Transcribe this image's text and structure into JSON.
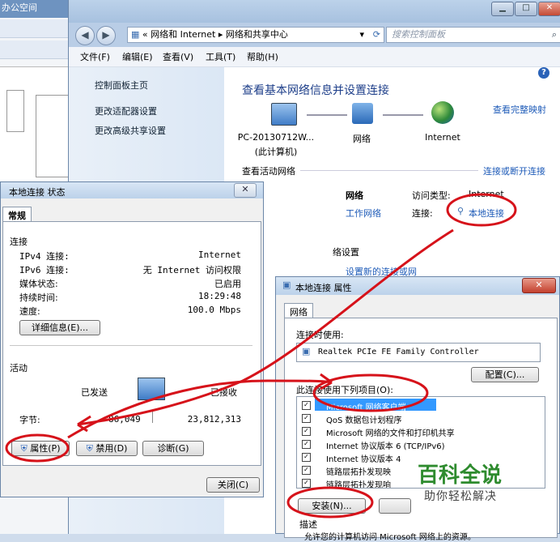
{
  "bg_app": {
    "title": "办公空间"
  },
  "window": {
    "breadcrumb_prefix": "«",
    "breadcrumb": [
      "网络和 Internet",
      "网络和共享中心"
    ],
    "search_placeholder": "搜索控制面板",
    "menu": [
      "文件(F)",
      "编辑(E)",
      "查看(V)",
      "工具(T)",
      "帮助(H)"
    ],
    "sidebar": [
      "控制面板主页",
      "更改适配器设置",
      "更改高级共享设置"
    ],
    "heading": "查看基本网络信息并设置连接",
    "full_map": "查看完整映射",
    "computer_name": "PC-20130712W...",
    "computer_sub": "(此计算机)",
    "network_label": "网络",
    "internet_label": "Internet",
    "active_networks": "查看活动网络",
    "connect_disconnect": "连接或断开连接",
    "net_name": "网络",
    "net_type": "工作网络",
    "access_type_label": "访问类型:",
    "access_type_value": "Internet",
    "connection_label": "连接:",
    "connection_value": "本地连接",
    "change_settings_partial": "络设置",
    "setup_link_partial": "设置新的连接或网"
  },
  "status_dialog": {
    "title": "本地连接 状态",
    "tab": "常规",
    "connection_section": "连接",
    "rows": [
      {
        "label": "IPv4 连接:",
        "value": "Internet"
      },
      {
        "label": "IPv6 连接:",
        "value": "无 Internet 访问权限"
      },
      {
        "label": "媒体状态:",
        "value": "已启用"
      },
      {
        "label": "持续时间:",
        "value": "18:29:48"
      },
      {
        "label": "速度:",
        "value": "100.0 Mbps"
      }
    ],
    "details_btn": "详细信息(E)...",
    "activity_section": "活动",
    "sent_label": "已发送",
    "received_label": "已接收",
    "bytes_label": "字节:",
    "bytes_sent": "86,049",
    "bytes_received": "23,812,313",
    "properties_btn": "属性(P)",
    "disable_btn": "禁用(D)",
    "diagnose_btn": "诊断(G)",
    "close_btn": "关闭(C)"
  },
  "props_dialog": {
    "title": "本地连接 属性",
    "tab": "网络",
    "connect_using_label": "连接时使用:",
    "adapter": "Realtek PCIe FE Family Controller",
    "configure_btn": "配置(C)...",
    "items_label": "此连接使用下列项目(O):",
    "items": [
      "Microsoft 网络客户端",
      "QoS 数据包计划程序",
      "Microsoft 网络的文件和打印机共享",
      "Internet 协议版本 6 (TCP/IPv6)",
      "Internet 协议版本 4",
      "链路层拓扑发现映",
      "链路层拓扑发现响"
    ],
    "install_btn": "安装(N)...",
    "description_label": "描述",
    "description_text": "允许您的计算机访问 Microsoft 网络上的资源。"
  },
  "watermark": {
    "main": "百科全说",
    "sub": "助你轻松解决"
  },
  "colors": {
    "annotation": "#d6121a",
    "link": "#1e5bb8",
    "watermark": "#2e8b2e"
  }
}
